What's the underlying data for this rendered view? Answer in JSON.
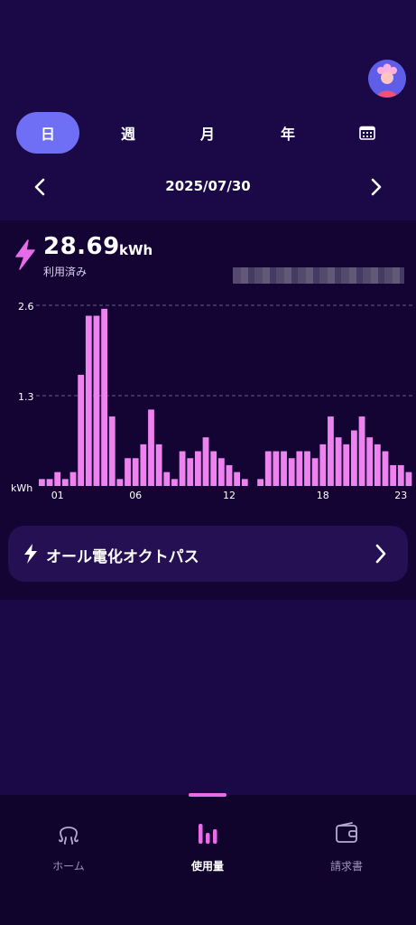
{
  "header": {
    "avatar_icon": "user-avatar"
  },
  "tabs": [
    {
      "label": "日",
      "active": true
    },
    {
      "label": "週",
      "active": false
    },
    {
      "label": "月",
      "active": false
    },
    {
      "label": "年",
      "active": false
    },
    {
      "label": "",
      "icon": "calendar-icon",
      "active": false
    }
  ],
  "date_nav": {
    "date": "2025/07/30",
    "prev_icon": "chevron-left-icon",
    "next_icon": "chevron-right-icon"
  },
  "usage": {
    "total": "28.69",
    "unit": "kWh",
    "label": "利用済み"
  },
  "chart_data": {
    "type": "bar",
    "ylabel": "kWh",
    "ylim": [
      0,
      2.6
    ],
    "yticks": [
      "2.6",
      "1.3"
    ],
    "xticks": [
      "01",
      "06",
      "12",
      "18",
      "23"
    ],
    "tick_indices": [
      2,
      12,
      24,
      36,
      46
    ],
    "bar_color": "#ee82ee",
    "grid_color": "#6a5a8a",
    "values": [
      0.1,
      0.1,
      0.2,
      0.1,
      0.2,
      1.6,
      2.45,
      2.45,
      2.55,
      1.0,
      0.1,
      0.4,
      0.4,
      0.6,
      1.1,
      0.6,
      0.2,
      0.1,
      0.5,
      0.4,
      0.5,
      0.7,
      0.5,
      0.4,
      0.3,
      0.2,
      0.1,
      0.0,
      0.1,
      0.5,
      0.5,
      0.5,
      0.4,
      0.5,
      0.5,
      0.4,
      0.6,
      1.0,
      0.7,
      0.6,
      0.8,
      1.0,
      0.7,
      0.6,
      0.5,
      0.3,
      0.3,
      0.2
    ]
  },
  "plan_card": {
    "label": "オール電化オクトパス",
    "icon": "bolt-icon"
  },
  "bottom_nav": [
    {
      "label": "ホーム",
      "icon": "octopus-icon",
      "active": false
    },
    {
      "label": "使用量",
      "icon": "bar-chart-icon",
      "active": true
    },
    {
      "label": "請求書",
      "icon": "wallet-icon",
      "active": false
    }
  ],
  "colors": {
    "background": "#1b0846",
    "panel": "#130434",
    "accent": "#6f6ff5",
    "bar": "#ee82ee"
  }
}
